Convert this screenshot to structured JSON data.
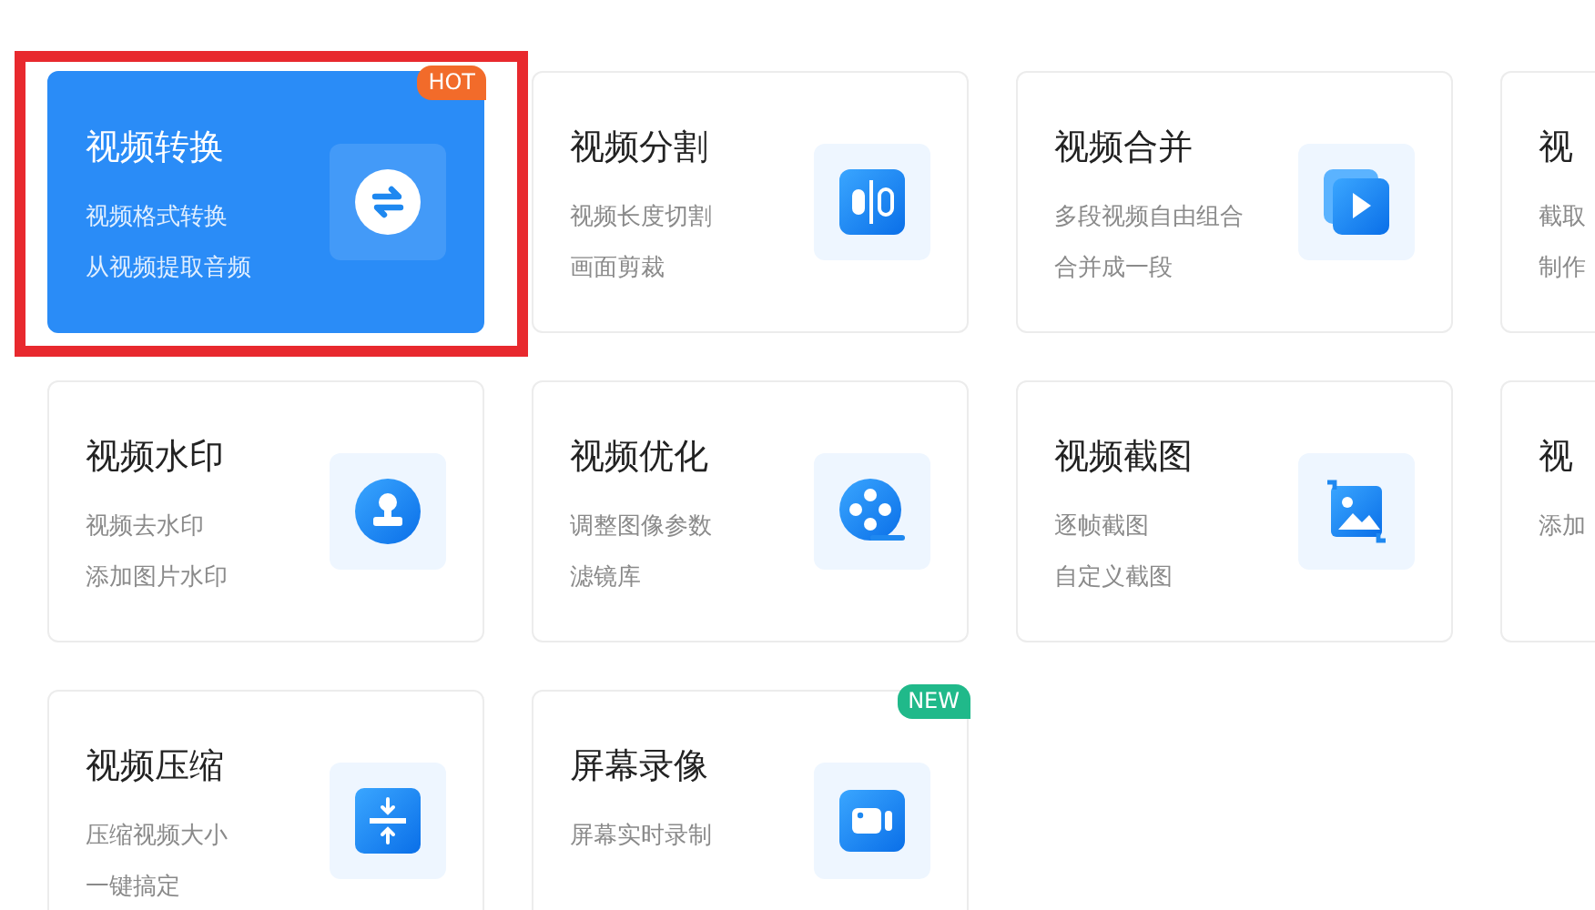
{
  "cards": [
    {
      "title": "视频转换",
      "lines": [
        "视频格式转换",
        "从视频提取音频"
      ],
      "kind": "convert",
      "selected": true,
      "highlighted": true,
      "badge": {
        "text": "HOT",
        "kind": "hot"
      }
    },
    {
      "title": "视频分割",
      "lines": [
        "视频长度切割",
        "画面剪裁"
      ],
      "kind": "split",
      "selected": false,
      "highlighted": false
    },
    {
      "title": "视频合并",
      "lines": [
        "多段视频自由组合",
        "合并成一段"
      ],
      "kind": "merge",
      "selected": false,
      "highlighted": false
    },
    {
      "title": "视",
      "lines": [
        "截取",
        "制作"
      ],
      "selected": false,
      "highlighted": false
    },
    {
      "title": "视频水印",
      "lines": [
        "视频去水印",
        "添加图片水印"
      ],
      "kind": "watermark",
      "selected": false,
      "highlighted": false
    },
    {
      "title": "视频优化",
      "lines": [
        "调整图像参数",
        "滤镜库"
      ],
      "kind": "optimize",
      "selected": false,
      "highlighted": false
    },
    {
      "title": "视频截图",
      "lines": [
        "逐帧截图",
        "自定义截图"
      ],
      "kind": "screenshot",
      "selected": false,
      "highlighted": false
    },
    {
      "title": "视",
      "lines": [
        "添加"
      ],
      "selected": false,
      "highlighted": false
    },
    {
      "title": "视频压缩",
      "lines": [
        "压缩视频大小",
        "一键搞定"
      ],
      "kind": "compress",
      "selected": false,
      "highlighted": false
    },
    {
      "title": "屏幕录像",
      "lines": [
        "屏幕实时录制"
      ],
      "kind": "record",
      "selected": false,
      "highlighted": false,
      "badge": {
        "text": "NEW",
        "kind": "new"
      }
    }
  ]
}
